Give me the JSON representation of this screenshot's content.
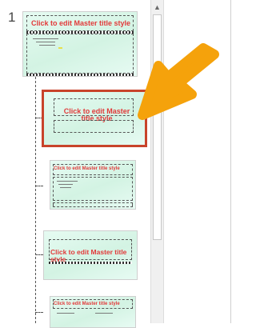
{
  "pane": {
    "slide_number": "1"
  },
  "master": {
    "title": "Click to edit Master title style"
  },
  "layouts": [
    {
      "title": "Click to edit Master title style"
    },
    {
      "title": "Click to edit Master title style"
    },
    {
      "title": "Click to edit Master title style"
    },
    {
      "title": "Click to edit Master title style"
    }
  ],
  "colors": {
    "title_red": "#e23a3a",
    "selection": "#c8442b",
    "arrow": "#f5a20b",
    "thumb_bg": "#dff7ec"
  },
  "icons": {
    "scroll_up": "▲"
  }
}
